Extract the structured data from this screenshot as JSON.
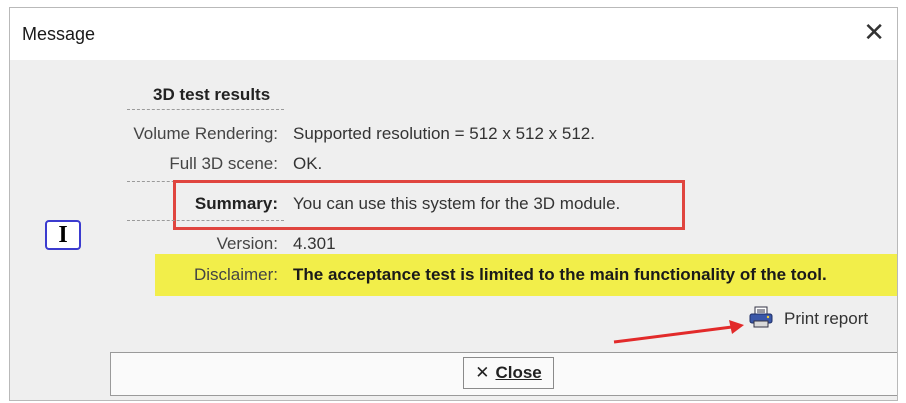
{
  "window": {
    "title": "Message",
    "close_glyph": "✕"
  },
  "icon": {
    "name": "info-icon",
    "glyph": "I"
  },
  "results": {
    "heading": "3D test results",
    "volume_rendering": {
      "label": "Volume Rendering:",
      "value": "Supported resolution = 512 x 512 x 512."
    },
    "full_scene": {
      "label": "Full 3D scene:",
      "value": "OK."
    },
    "summary": {
      "label": "Summary:",
      "value": "You can use this system for the 3D module."
    },
    "version": {
      "label": "Version:",
      "value": "4.301"
    },
    "disclaimer": {
      "label": "Disclaimer:",
      "value": "The acceptance test is limited to the main functionality of the tool."
    }
  },
  "print_report": {
    "label": "Print report",
    "icon": "printer-icon"
  },
  "close_button": {
    "glyph": "✕",
    "label": "Close"
  },
  "colors": {
    "highlight_box": "#e0453f",
    "disclaimer_band": "#f2ee4a",
    "arrow": "#e22a2a",
    "info_icon_border": "#3b3bcf"
  }
}
